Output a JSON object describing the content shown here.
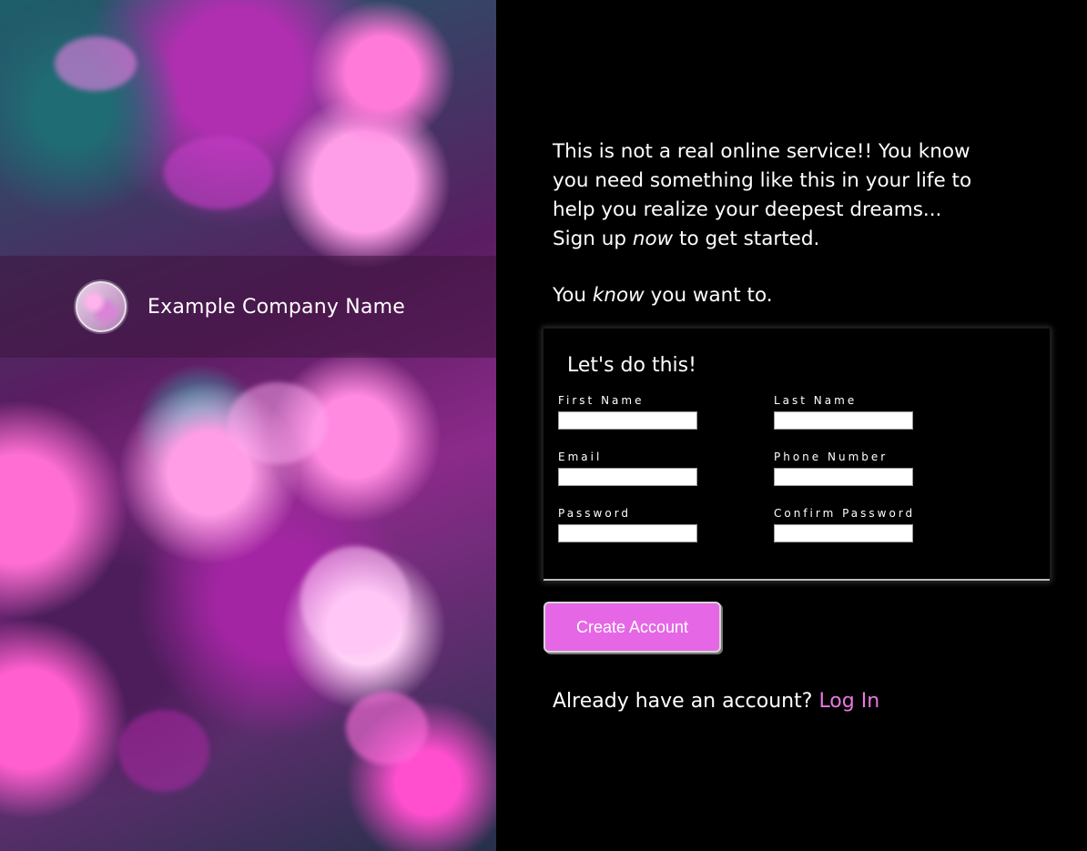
{
  "hero": {
    "company_name": "Example Company Name"
  },
  "intro": {
    "line1": "This is not a real online service!! You know you need something like this in your life to help you realize your deepest dreams...",
    "line2_pre": "Sign up ",
    "line2_em": "now",
    "line2_post": " to get started.",
    "line3_pre": "You ",
    "line3_em": "know",
    "line3_post": " you want to."
  },
  "form": {
    "title": "Let's do this!",
    "first_name_label": "First Name",
    "last_name_label": "Last Name",
    "email_label": "Email",
    "phone_label": "Phone Number",
    "password_label": "Password",
    "confirm_password_label": "Confirm Password"
  },
  "actions": {
    "create_account_label": "Create Account",
    "already_text": "Already have an account? ",
    "login_link": "Log In"
  },
  "colors": {
    "accent": "#e667e6",
    "link": "#e978e0",
    "background": "#000000"
  }
}
